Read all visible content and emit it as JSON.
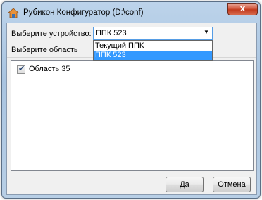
{
  "window": {
    "title": "Рубикон Конфигуратор (D:\\conf)",
    "close_label": "x"
  },
  "form": {
    "device_label": "Выберите устройство:",
    "device_value": "ППК 523",
    "area_label": "Выберите область"
  },
  "dropdown": {
    "options": [
      "Текущий ППК",
      "ППК 523"
    ],
    "selected": "ППК 523"
  },
  "areas": [
    {
      "label": "Область 35",
      "checked": true
    }
  ],
  "buttons": {
    "ok": "Да",
    "cancel": "Отмена"
  },
  "colors": {
    "selection": "#3399ff",
    "focus_border": "#569de5",
    "close_button": "#c23b1e"
  }
}
